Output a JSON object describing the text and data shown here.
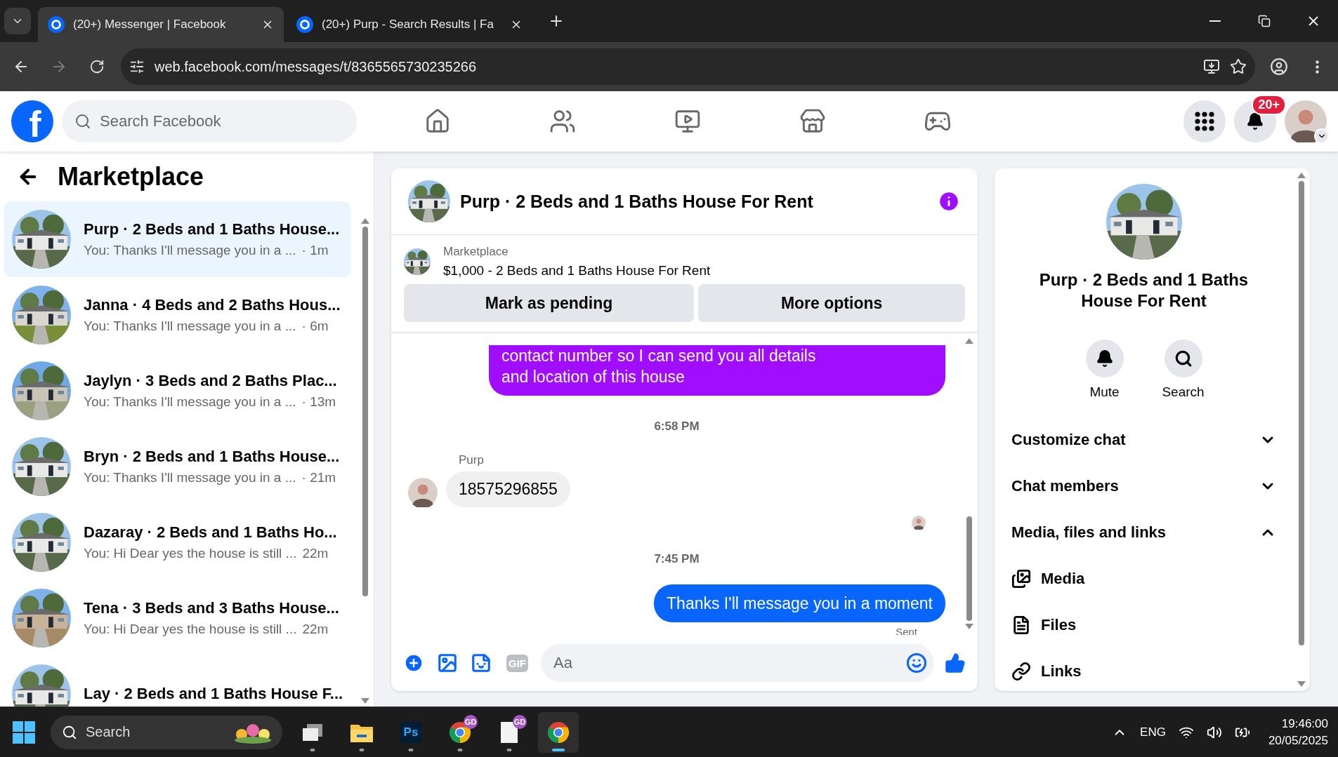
{
  "browser": {
    "tabs": [
      {
        "title": "(20+) Messenger | Facebook",
        "selected": true
      },
      {
        "title": "(20+) Purp - Search Results | Fa",
        "selected": false
      }
    ],
    "url": "web.facebook.com/messages/t/8365565730235266"
  },
  "facebook": {
    "logo": "f",
    "search_placeholder": "Search Facebook",
    "notification_badge": "20+"
  },
  "conversation_list": {
    "title": "Marketplace",
    "items": [
      {
        "name": "Purp · 2 Beds and 1 Baths House...",
        "preview": "You: Thanks I'll message you in a ...",
        "time": "· 1m",
        "selected": true
      },
      {
        "name": "Janna · 4 Beds and 2 Baths Hous...",
        "preview": "You: Thanks I'll message you in a ...",
        "time": "· 6m",
        "selected": false
      },
      {
        "name": "Jaylyn · 3 Beds and 2 Baths Plac...",
        "preview": "You: Thanks I'll message you in a ...",
        "time": "· 13m",
        "selected": false
      },
      {
        "name": "Bryn · 2 Beds and 1 Baths House...",
        "preview": "You: Thanks I'll message you in a ...",
        "time": "· 21m",
        "selected": false
      },
      {
        "name": "Dazaray · 2 Beds and 1 Baths Ho...",
        "preview": "You: Hi Dear yes the house is still ...",
        "time": "22m",
        "selected": false
      },
      {
        "name": "Tena · 3 Beds and 3 Baths House...",
        "preview": "You: Hi Dear yes the house is still ...",
        "time": "22m",
        "selected": false
      },
      {
        "name": "Lay · 2 Beds and 1 Baths House F...",
        "selected": false
      }
    ]
  },
  "chat": {
    "title": "Purp · 2 Beds and 1 Baths House For Rent",
    "listing": {
      "label": "Marketplace",
      "title": "$1,000 - 2 Beds and 1 Baths House For Rent"
    },
    "buttons": [
      "Mark as pending",
      "More options"
    ],
    "messages": [
      {
        "kind": "outgoing",
        "lines": [
          "contact number so I can send you all details",
          "and location of this house"
        ],
        "color": "#a10dff"
      },
      {
        "kind": "time",
        "text": "6:58 PM"
      },
      {
        "kind": "incoming",
        "sender": "Purp",
        "text": "18575296855"
      },
      {
        "kind": "seen"
      },
      {
        "kind": "time",
        "text": "7:45 PM"
      },
      {
        "kind": "outgoing",
        "lines": [
          "Thanks I'll message you in a moment"
        ],
        "color": "#0866ff"
      },
      {
        "kind": "status",
        "text": "Sent"
      }
    ],
    "composer": {
      "gif_label": "GIF",
      "placeholder": "Aa"
    }
  },
  "info_panel": {
    "title": "Purp · 2 Beds and 1 Baths House For Rent",
    "actions": [
      {
        "kind": "mute",
        "label": "Mute"
      },
      {
        "kind": "search",
        "label": "Search"
      }
    ],
    "sections": [
      {
        "label": "Customize chat",
        "expanded": false
      },
      {
        "label": "Chat members",
        "expanded": false
      },
      {
        "label": "Media, files and links",
        "expanded": true,
        "children": [
          {
            "kind": "media",
            "label": "Media"
          },
          {
            "kind": "files",
            "label": "Files"
          },
          {
            "kind": "links",
            "label": "Links"
          }
        ]
      }
    ]
  },
  "taskbar": {
    "search": "Search",
    "apps": [
      {
        "kind": "taskview"
      },
      {
        "kind": "explorer"
      },
      {
        "kind": "photoshop",
        "label": "Ps"
      },
      {
        "kind": "chrome",
        "badge": "GD"
      },
      {
        "kind": "file",
        "badge": "GD"
      },
      {
        "kind": "chrome_profile",
        "selected": true
      }
    ],
    "language": "ENG",
    "time": "19:46:00",
    "date": "20/05/2025"
  }
}
